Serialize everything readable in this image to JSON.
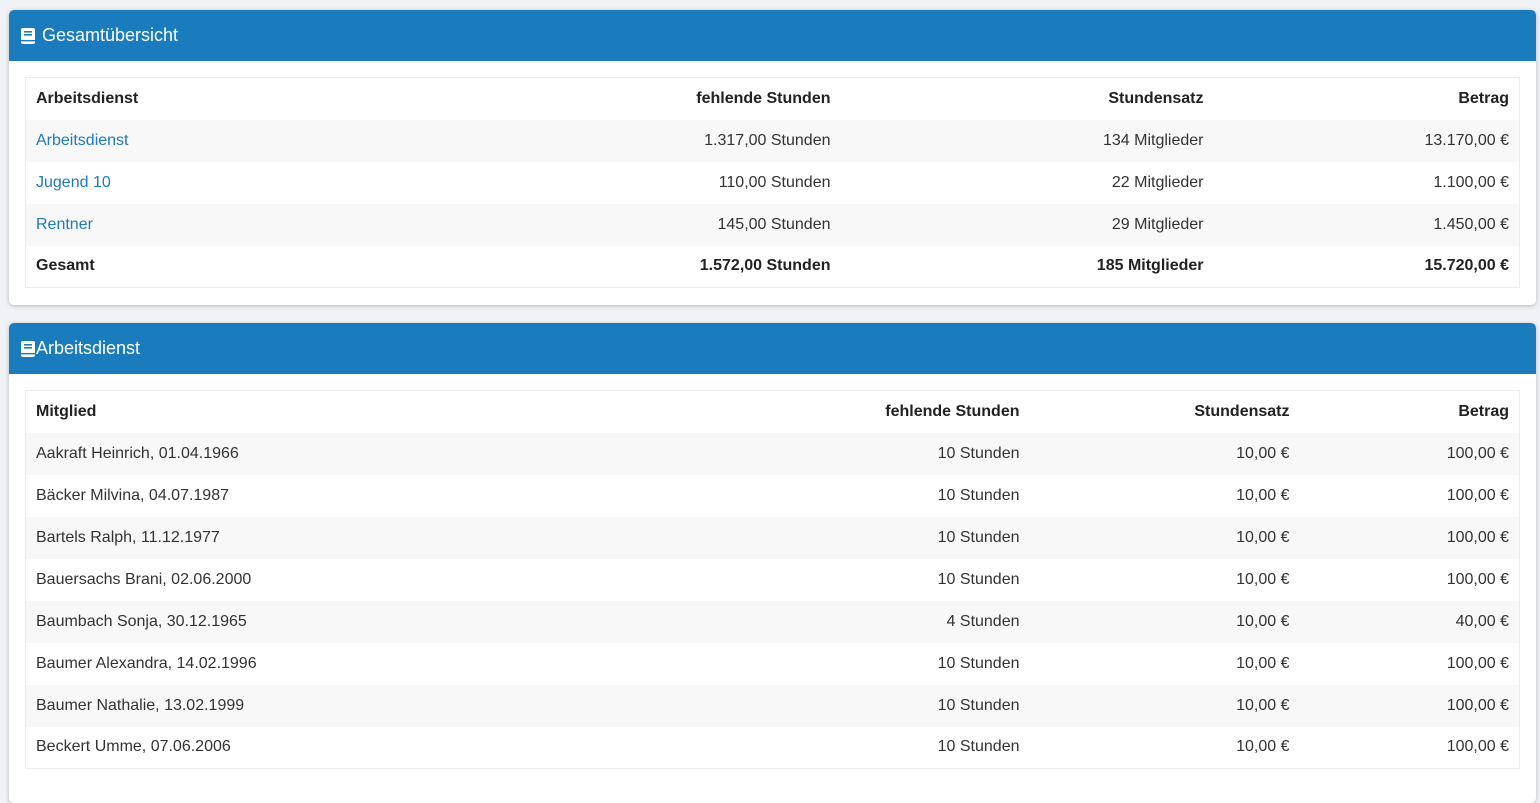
{
  "overview": {
    "title": "Gesamtübersicht",
    "icon": "book-icon",
    "columns": [
      "Arbeitsdienst",
      "fehlende Stunden",
      "Stundensatz",
      "Betrag"
    ],
    "rows": [
      {
        "name": "Arbeitsdienst",
        "hours": "1.317,00 Stunden",
        "rate": "134 Mitglieder",
        "amount": "13.170,00 €"
      },
      {
        "name": "Jugend 10",
        "hours": "110,00 Stunden",
        "rate": "22 Mitglieder",
        "amount": "1.100,00 €"
      },
      {
        "name": "Rentner",
        "hours": "145,00 Stunden",
        "rate": "29 Mitglieder",
        "amount": "1.450,00 €"
      }
    ],
    "total": {
      "name": "Gesamt",
      "hours": "1.572,00 Stunden",
      "rate": "185 Mitglieder",
      "amount": "15.720,00 €"
    }
  },
  "detail": {
    "title": "Arbeitsdienst",
    "icon": "book-icon",
    "columns": [
      "Mitglied",
      "fehlende Stunden",
      "Stundensatz",
      "Betrag"
    ],
    "rows": [
      {
        "member": "Aakraft Heinrich, 01.04.1966",
        "hours": "10 Stunden",
        "rate": "10,00 €",
        "amount": "100,00 €"
      },
      {
        "member": "Bäcker Milvina, 04.07.1987",
        "hours": "10 Stunden",
        "rate": "10,00 €",
        "amount": "100,00 €"
      },
      {
        "member": "Bartels Ralph, 11.12.1977",
        "hours": "10 Stunden",
        "rate": "10,00 €",
        "amount": "100,00 €"
      },
      {
        "member": "Bauersachs Brani, 02.06.2000",
        "hours": "10 Stunden",
        "rate": "10,00 €",
        "amount": "100,00 €"
      },
      {
        "member": "Baumbach Sonja, 30.12.1965",
        "hours": "4 Stunden",
        "rate": "10,00 €",
        "amount": "40,00 €"
      },
      {
        "member": "Baumer Alexandra, 14.02.1996",
        "hours": "10 Stunden",
        "rate": "10,00 €",
        "amount": "100,00 €"
      },
      {
        "member": "Baumer Nathalie, 13.02.1999",
        "hours": "10 Stunden",
        "rate": "10,00 €",
        "amount": "100,00 €"
      },
      {
        "member": "Beckert Umme, 07.06.2006",
        "hours": "10 Stunden",
        "rate": "10,00 €",
        "amount": "100,00 €"
      }
    ]
  },
  "colors": {
    "header": "#1a7bbd",
    "link": "#1f7ab8",
    "stripe": "#f8f8f8"
  }
}
